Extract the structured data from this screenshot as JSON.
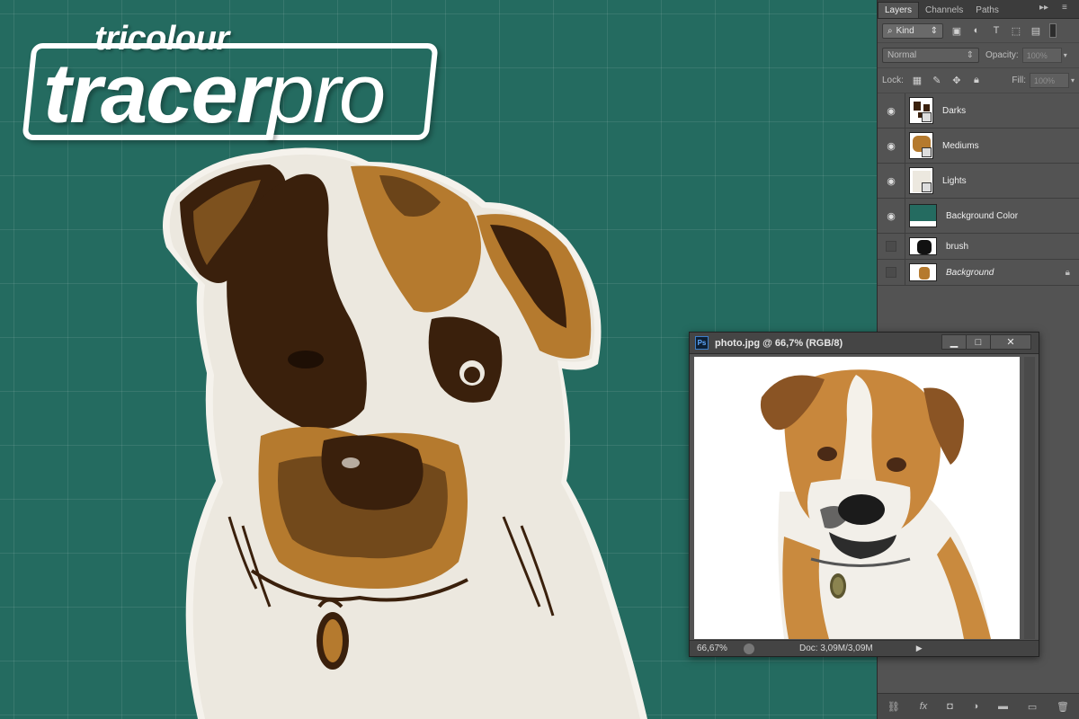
{
  "logo": {
    "line1": "tricolour",
    "part_bold": "tracer",
    "part_thin": "pro"
  },
  "colors": {
    "canvas_bg": "#246b60",
    "dark": "#3a200c",
    "medium": "#b57a2e",
    "light": "#ece8df",
    "panel": "#535353"
  },
  "panel": {
    "tabs": [
      "Layers",
      "Channels",
      "Paths"
    ],
    "filter": {
      "label": "Kind"
    },
    "blend_mode": "Normal",
    "opacity_label": "Opacity:",
    "opacity_value": "100%",
    "lock_label": "Lock:",
    "fill_label": "Fill:",
    "fill_value": "100%",
    "layers": [
      {
        "name": "Darks",
        "visible": true
      },
      {
        "name": "Mediums",
        "visible": true
      },
      {
        "name": "Lights",
        "visible": true
      },
      {
        "name": "Background Color",
        "visible": true
      },
      {
        "name": "brush",
        "visible": false
      },
      {
        "name": "Background",
        "visible": false,
        "locked": true
      }
    ],
    "footer_icons": [
      "link-icon",
      "fx-icon",
      "mask-icon",
      "adjustment-icon",
      "folder-icon",
      "new-layer-icon",
      "trash-icon"
    ]
  },
  "document_window": {
    "title": "photo.jpg @ 66,7% (RGB/8)",
    "app_badge": "Ps",
    "zoom": "66,67%",
    "doc_info": "Doc: 3,09M/3,09M",
    "buttons": {
      "minimize": "▁",
      "maximize": "□",
      "close": "✕"
    }
  }
}
